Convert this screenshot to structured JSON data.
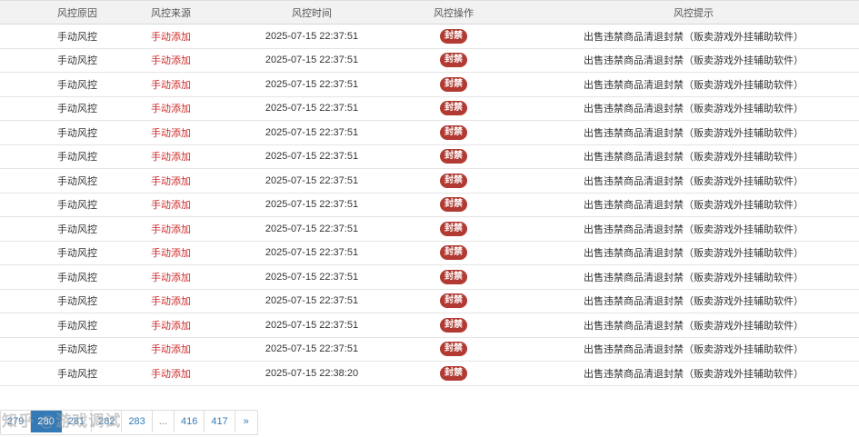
{
  "table": {
    "headers": [
      "风控原因",
      "风控来源",
      "风控时间",
      "风控操作",
      "风控提示"
    ],
    "rows": [
      {
        "reason": "手动风控",
        "source": "手动添加",
        "time": "2025-07-15 22:37:51",
        "action": "封禁",
        "tip": "出售违禁商品清退封禁（贩卖游戏外挂辅助软件）"
      },
      {
        "reason": "手动风控",
        "source": "手动添加",
        "time": "2025-07-15 22:37:51",
        "action": "封禁",
        "tip": "出售违禁商品清退封禁（贩卖游戏外挂辅助软件）"
      },
      {
        "reason": "手动风控",
        "source": "手动添加",
        "time": "2025-07-15 22:37:51",
        "action": "封禁",
        "tip": "出售违禁商品清退封禁（贩卖游戏外挂辅助软件）"
      },
      {
        "reason": "手动风控",
        "source": "手动添加",
        "time": "2025-07-15 22:37:51",
        "action": "封禁",
        "tip": "出售违禁商品清退封禁（贩卖游戏外挂辅助软件）"
      },
      {
        "reason": "手动风控",
        "source": "手动添加",
        "time": "2025-07-15 22:37:51",
        "action": "封禁",
        "tip": "出售违禁商品清退封禁（贩卖游戏外挂辅助软件）"
      },
      {
        "reason": "手动风控",
        "source": "手动添加",
        "time": "2025-07-15 22:37:51",
        "action": "封禁",
        "tip": "出售违禁商品清退封禁（贩卖游戏外挂辅助软件）"
      },
      {
        "reason": "手动风控",
        "source": "手动添加",
        "time": "2025-07-15 22:37:51",
        "action": "封禁",
        "tip": "出售违禁商品清退封禁（贩卖游戏外挂辅助软件）"
      },
      {
        "reason": "手动风控",
        "source": "手动添加",
        "time": "2025-07-15 22:37:51",
        "action": "封禁",
        "tip": "出售违禁商品清退封禁（贩卖游戏外挂辅助软件）"
      },
      {
        "reason": "手动风控",
        "source": "手动添加",
        "time": "2025-07-15 22:37:51",
        "action": "封禁",
        "tip": "出售违禁商品清退封禁（贩卖游戏外挂辅助软件）"
      },
      {
        "reason": "手动风控",
        "source": "手动添加",
        "time": "2025-07-15 22:37:51",
        "action": "封禁",
        "tip": "出售违禁商品清退封禁（贩卖游戏外挂辅助软件）"
      },
      {
        "reason": "手动风控",
        "source": "手动添加",
        "time": "2025-07-15 22:37:51",
        "action": "封禁",
        "tip": "出售违禁商品清退封禁（贩卖游戏外挂辅助软件）"
      },
      {
        "reason": "手动风控",
        "source": "手动添加",
        "time": "2025-07-15 22:37:51",
        "action": "封禁",
        "tip": "出售违禁商品清退封禁（贩卖游戏外挂辅助软件）"
      },
      {
        "reason": "手动风控",
        "source": "手动添加",
        "time": "2025-07-15 22:37:51",
        "action": "封禁",
        "tip": "出售违禁商品清退封禁（贩卖游戏外挂辅助软件）"
      },
      {
        "reason": "手动风控",
        "source": "手动添加",
        "time": "2025-07-15 22:37:51",
        "action": "封禁",
        "tip": "出售违禁商品清退封禁（贩卖游戏外挂辅助软件）"
      },
      {
        "reason": "手动风控",
        "source": "手动添加",
        "time": "2025-07-15 22:38:20",
        "action": "封禁",
        "tip": "出售违禁商品清退封禁（贩卖游戏外挂辅助软件）"
      }
    ]
  },
  "pagination": {
    "pages": [
      {
        "label": "279",
        "active": false
      },
      {
        "label": "280",
        "active": true
      },
      {
        "label": "281",
        "active": false
      },
      {
        "label": "282",
        "active": false
      },
      {
        "label": "283",
        "active": false
      },
      {
        "label": "...",
        "active": false
      },
      {
        "label": "416",
        "active": false
      },
      {
        "label": "417",
        "active": false
      },
      {
        "label": "»",
        "active": false
      }
    ]
  },
  "watermark": {
    "text": "知乎 @游戏调试"
  },
  "colors": {
    "source_text": "#cc2b2b",
    "badge_bg": "#b33a32",
    "page_active": "#337ab7",
    "link": "#337ab7"
  }
}
